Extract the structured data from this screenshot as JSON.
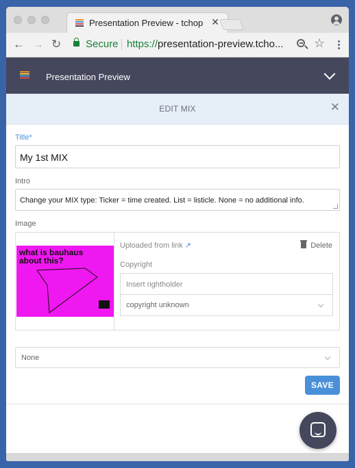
{
  "browser": {
    "tab_title": "Presentation Preview - tchop",
    "tab_close": "✕",
    "secure_label": "Secure",
    "url_scheme": "https://",
    "url_host": "presentation-preview.tcho...",
    "nav_back": "←",
    "nav_forward": "→",
    "nav_reload": "↻",
    "star": "☆"
  },
  "app": {
    "title": "Presentation Preview"
  },
  "edit": {
    "header": "EDIT MIX",
    "close": "✕",
    "title_label": "Title*",
    "title_value": "My 1st MIX",
    "intro_label": "Intro",
    "intro_value": "Change your MIX type: Ticker = time created. List = listicle. None = no additional info.",
    "image_label": "Image",
    "thumbnail_text": "what is bauhaus about this?",
    "uploaded_label": "Uploaded from link",
    "uploaded_arrow": "↗",
    "delete_label": "Delete",
    "copyright_label": "Copyright",
    "rightholder_placeholder": "Insert rightholder",
    "copyright_select": "copyright unknown",
    "type_select": "None",
    "save_label": "SAVE"
  },
  "colors": {
    "app_bar": "#45475c",
    "accent": "#4a90d9",
    "thumbnail_bg": "#f018f0",
    "secure_green": "#188038"
  }
}
